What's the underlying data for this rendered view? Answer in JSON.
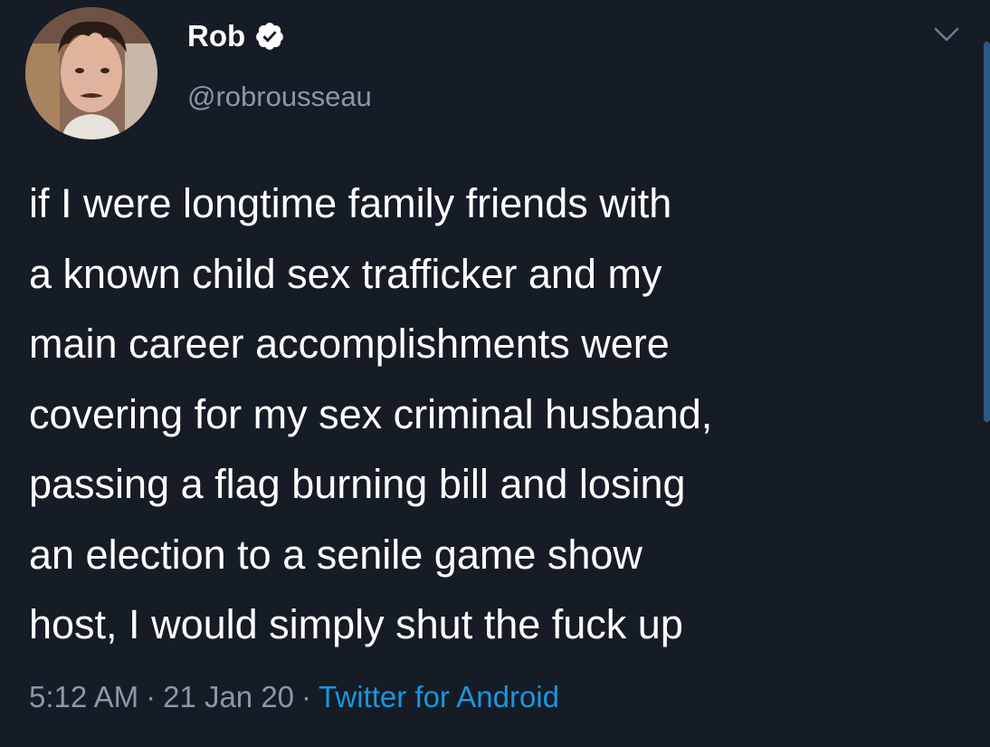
{
  "author": {
    "display_name": "Rob",
    "handle": "@robrousseau",
    "verified": true
  },
  "icons": {
    "verified": "verified-badge-icon",
    "menu": "chevron-down-icon"
  },
  "tweet": {
    "text": "if I were longtime family friends with\na known child sex trafficker and my\nmain career accomplishments were\ncovering for my sex criminal husband,\npassing a flag burning bill and losing\nan election to a senile game show\nhost, I would simply shut the fuck up"
  },
  "meta": {
    "time": "5:12 AM",
    "separator": "·",
    "date": "21 Jan 20",
    "source": "Twitter for Android"
  },
  "colors": {
    "background": "#161c26",
    "primary_text": "#ffffff",
    "secondary_text": "#8899a6",
    "accent": "#1b95e0"
  }
}
